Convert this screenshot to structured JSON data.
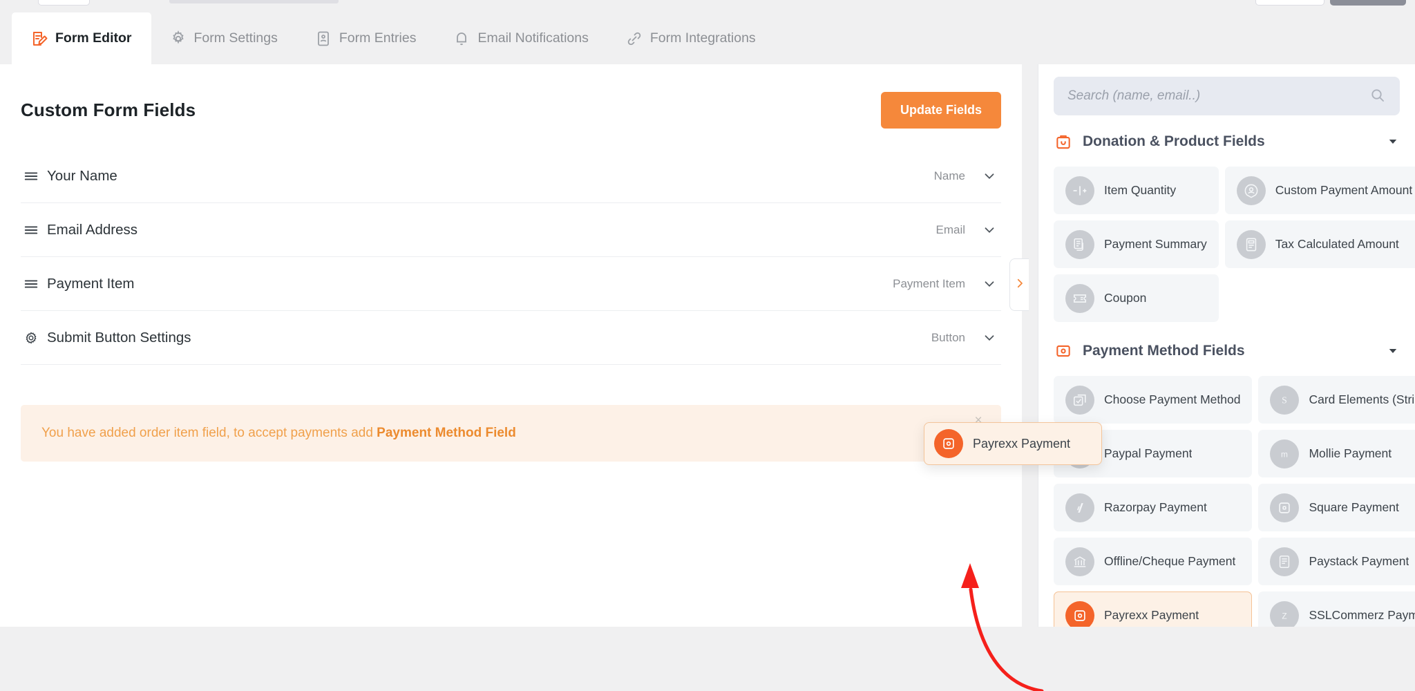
{
  "tabs": [
    {
      "label": "Form Editor",
      "icon": "form-editor-icon",
      "active": true
    },
    {
      "label": "Form Settings",
      "icon": "gear-icon",
      "active": false
    },
    {
      "label": "Form Entries",
      "icon": "entries-icon",
      "active": false
    },
    {
      "label": "Email Notifications",
      "icon": "bell-icon",
      "active": false
    },
    {
      "label": "Form Integrations",
      "icon": "link-icon",
      "active": false
    }
  ],
  "editor": {
    "title": "Custom Form Fields",
    "update_button": "Update Fields",
    "fields": [
      {
        "label": "Your Name",
        "type": "Name",
        "handle": "drag-handle-icon"
      },
      {
        "label": "Email Address",
        "type": "Email",
        "handle": "drag-handle-icon"
      },
      {
        "label": "Payment Item",
        "type": "Payment Item",
        "handle": "drag-handle-icon"
      },
      {
        "label": "Submit Button Settings",
        "type": "Button",
        "handle": "cog-icon"
      }
    ],
    "notice": {
      "text_before": "You have added order item field, to accept payments add ",
      "text_strong": "Payment Method Field",
      "close": "×",
      "color": "#f0a04b",
      "background": "#fdf1e7"
    }
  },
  "collapse_handle": {
    "icon": "chevron-right-icon",
    "color": "#f5883b"
  },
  "sidebar": {
    "search": {
      "value": "",
      "placeholder": "Search (name, email..)",
      "icon": "search-icon"
    },
    "sections": [
      {
        "title": "Donation & Product Fields",
        "icon": "shopping-bag-icon",
        "expanded": true,
        "items": [
          {
            "label": "Item Quantity",
            "icon": "quantity-stepper-icon",
            "highlight": false
          },
          {
            "label": "Custom Payment Amount",
            "icon": "user-amount-icon",
            "highlight": false
          },
          {
            "label": "Payment Summary",
            "icon": "summary-icon",
            "highlight": false
          },
          {
            "label": "Tax Calculated Amount",
            "icon": "document-icon",
            "highlight": false
          },
          {
            "label": "Coupon",
            "icon": "ticket-icon",
            "highlight": false
          }
        ]
      },
      {
        "title": "Payment Method Fields",
        "icon": "payment-card-icon",
        "expanded": true,
        "items": [
          {
            "label": "Choose Payment Method",
            "icon": "checkbox-icon",
            "highlight": false
          },
          {
            "label": "Card Elements (Stripe)",
            "icon": "stripe-icon",
            "highlight": false
          },
          {
            "label": "Paypal Payment",
            "icon": "paypal-icon",
            "highlight": false
          },
          {
            "label": "Mollie Payment",
            "icon": "mollie-icon",
            "highlight": false
          },
          {
            "label": "Razorpay Payment",
            "icon": "razorpay-icon",
            "highlight": false
          },
          {
            "label": "Square Payment",
            "icon": "square-icon",
            "highlight": false
          },
          {
            "label": "Offline/Cheque Payment",
            "icon": "bank-icon",
            "highlight": false
          },
          {
            "label": "Paystack Payment",
            "icon": "paystack-icon",
            "highlight": false
          },
          {
            "label": "Payrexx Payment",
            "icon": "payrexx-icon",
            "highlight": true
          },
          {
            "label": "SSLCommerz Payment",
            "icon": "sslcommerz-icon",
            "highlight": false
          }
        ]
      }
    ]
  },
  "drag_ghost": {
    "label": "Payrexx Payment",
    "icon": "payrexx-icon"
  },
  "annotation": {
    "type": "curved-arrow",
    "color": "#f5201b"
  },
  "colors": {
    "accent": "#f5883b",
    "highlight_orange": "#f4642a",
    "notice_text": "#f0a04b",
    "panel_bg": "#ffffff",
    "app_bg": "#f0f0f1",
    "card_bg": "#f4f6f8",
    "search_bg": "#e7eaf1"
  }
}
